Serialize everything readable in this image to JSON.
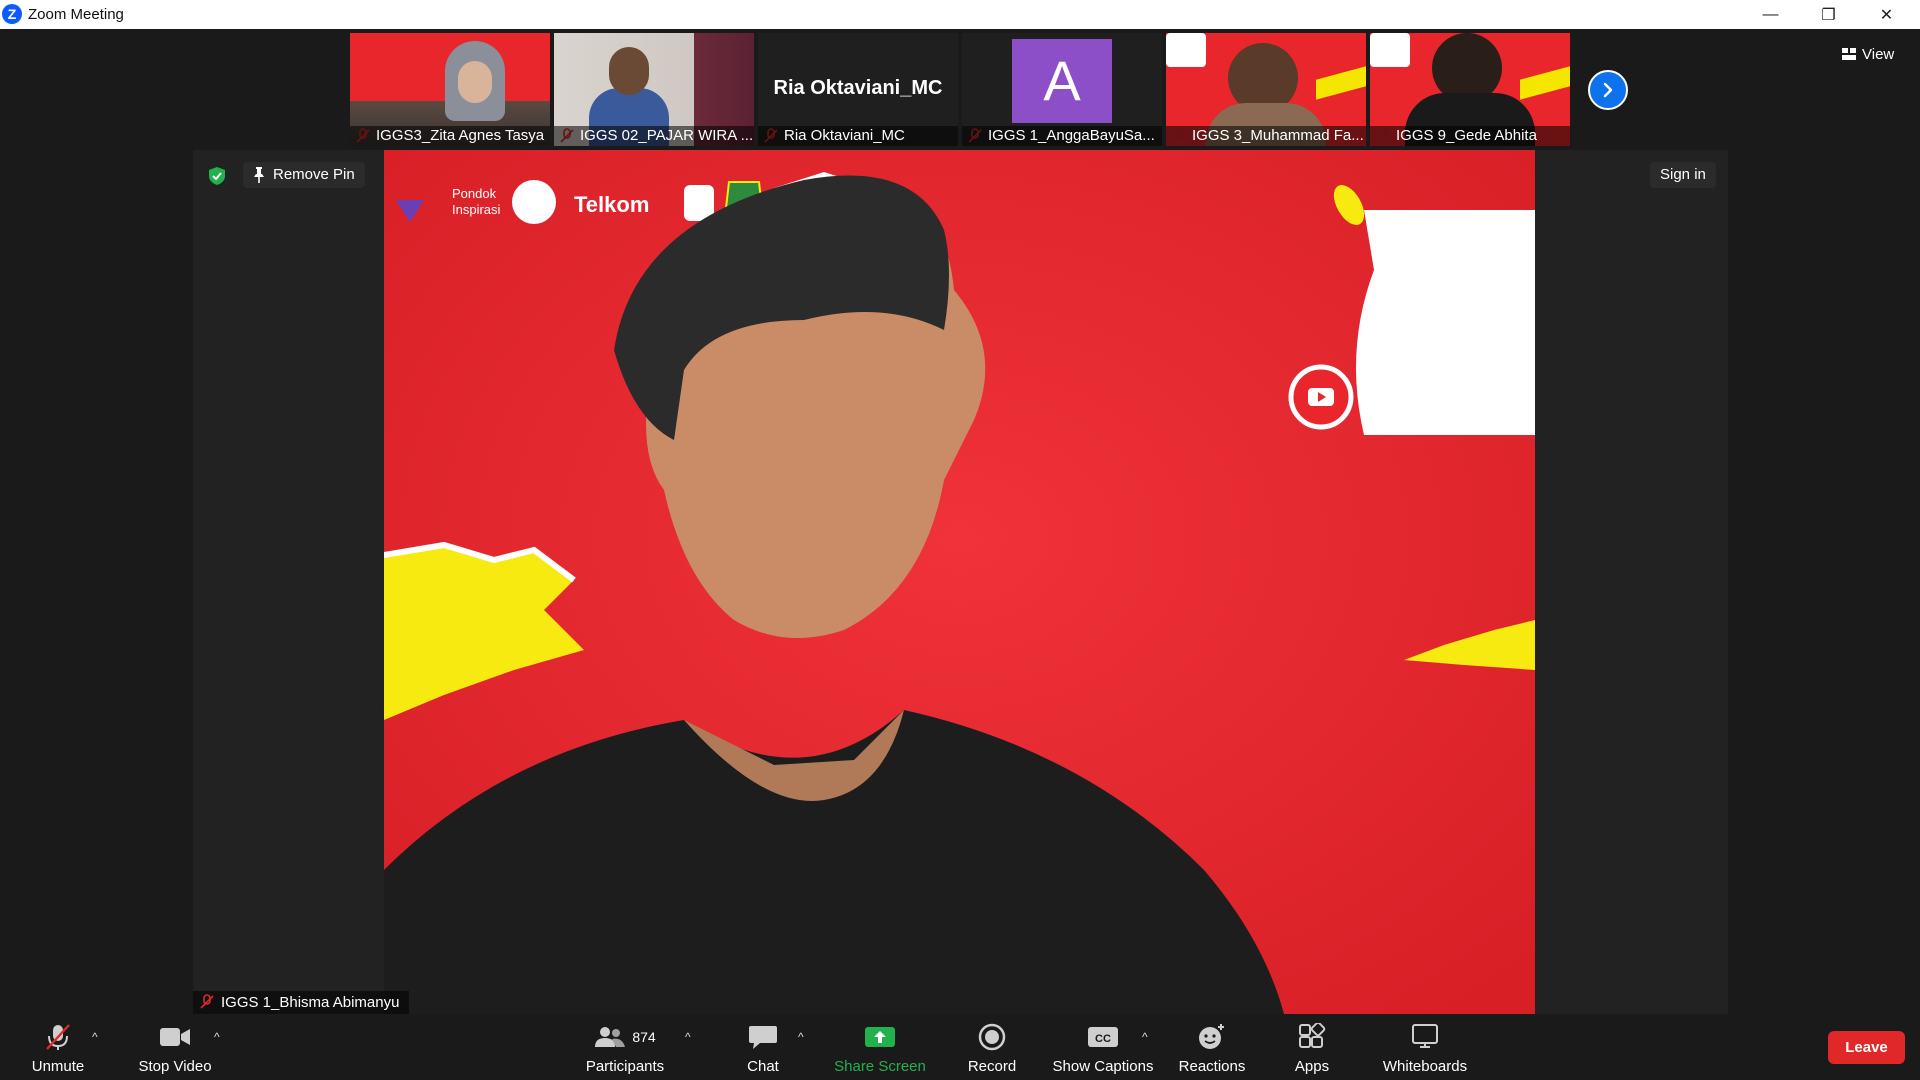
{
  "window": {
    "title": "Zoom Meeting",
    "minimize": "—",
    "maximize": "❐",
    "close": "✕"
  },
  "filmstrip": {
    "tiles": [
      {
        "name": "IGGS3_Zita Agnes Tasya"
      },
      {
        "name": "IGGS 02_PAJAR WIRA ..."
      },
      {
        "name": "Ria Oktaviani_MC",
        "display_name": "Ria Oktaviani_MC"
      },
      {
        "name": "IGGS 1_AnggaBayuSa...",
        "avatar_letter": "A"
      },
      {
        "name": "IGGS 3_Muhammad Fa..."
      },
      {
        "name": "IGGS 9_Gede Abhita"
      }
    ],
    "view_label": "View"
  },
  "stage": {
    "remove_pin": "Remove Pin",
    "sign_in": "Sign in",
    "pinned_name": "IGGS 1_Bhisma Abimanyu"
  },
  "toolbar": {
    "unmute": "Unmute",
    "stop_video": "Stop Video",
    "participants": "Participants",
    "participants_count": "874",
    "chat": "Chat",
    "share_screen": "Share Screen",
    "record": "Record",
    "show_captions": "Show Captions",
    "reactions": "Reactions",
    "apps": "Apps",
    "whiteboards": "Whiteboards",
    "leave": "Leave"
  },
  "colors": {
    "accent": "#0e72ed",
    "leave": "#e02828",
    "share": "#22b14c",
    "muted": "#e02828",
    "backdrop": "#e8262c"
  }
}
